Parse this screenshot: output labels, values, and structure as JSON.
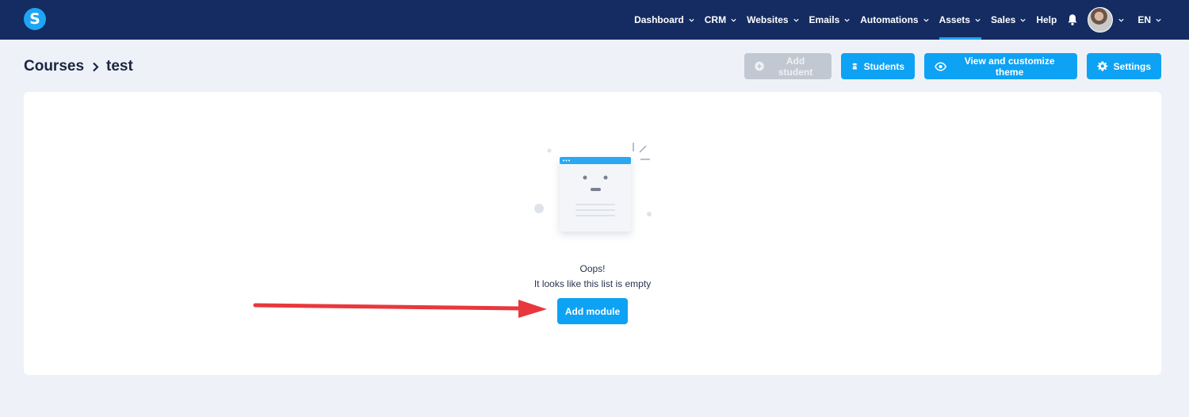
{
  "nav": {
    "logo": "S",
    "items": [
      {
        "label": "Dashboard"
      },
      {
        "label": "CRM"
      },
      {
        "label": "Websites"
      },
      {
        "label": "Emails"
      },
      {
        "label": "Automations"
      },
      {
        "label": "Assets"
      },
      {
        "label": "Sales"
      },
      {
        "label": "Help"
      }
    ],
    "active_item": "Assets",
    "language": "EN"
  },
  "breadcrumb": {
    "root": "Courses",
    "current": "test"
  },
  "actions": {
    "add_student": "Add student",
    "students": "Students",
    "theme": "View and customize theme",
    "settings": "Settings"
  },
  "empty_state": {
    "title": "Oops!",
    "subtitle": "It looks like this list is empty",
    "button": "Add module"
  },
  "colors": {
    "topbar": "#142c61",
    "primary": "#0ea2f4",
    "disabled": "#c2c8d1",
    "background": "#eef2f8",
    "arrow": "#e8383d"
  },
  "icons": {
    "logo": "s-logo-icon",
    "chevron": "chevron-down-icon",
    "bell": "bell-icon",
    "add_student": "plus-circle-icon",
    "students": "graduation-cap-icon",
    "theme": "eye-icon",
    "settings": "gear-icon"
  }
}
